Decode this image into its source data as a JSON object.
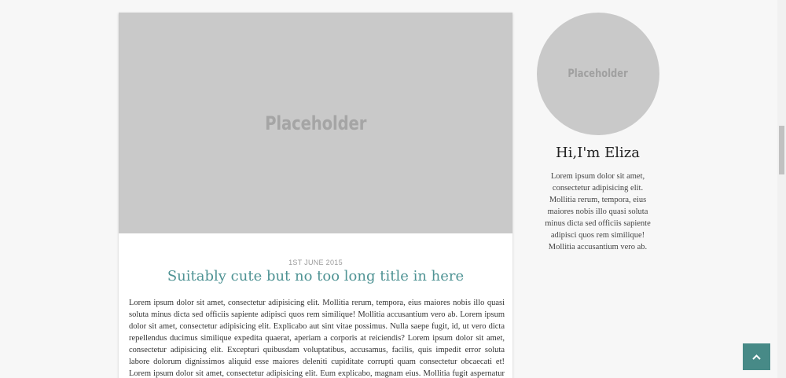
{
  "post": {
    "image_placeholder": "Placeholder",
    "date": "1ST JUNE 2015",
    "title": "Suitably cute but no too long title in here",
    "body": "Lorem ipsum dolor sit amet, consectetur adipisicing elit. Mollitia rerum, tempora, eius maiores nobis illo quasi soluta minus dicta sed officiis sapiente adipisci quos rem similique! Mollitia accusantium vero ab. Lorem ipsum dolor sit amet, consectetur adipisicing elit. Explicabo aut sint vitae possimus. Nulla saepe fugit, id, ut vero dicta repellendus ducimus similique expedita quaerat, aperiam a corporis at reiciendis? Lorem ipsum dolor sit amet, consectetur adipisicing elit. Excepturi quibusdam voluptatibus, accusamus, facilis, quis impedit error soluta labore dolorum dignissimos aliquid esse maiores deleniti cupiditate corrupti quam consectetur obcaecati et! Lorem ipsum dolor sit amet, consectetur adipisicing elit. Eum explicabo, magnam eius. Mollitia fugit aspernatur architecto eius amet delectus porro! Amet nemo eos"
  },
  "profile": {
    "avatar_placeholder": "Placeholder",
    "heading": "Hi,I'm Eliza",
    "bio": "Lorem ipsum dolor sit amet, consectetur adipisicing elit. Mollitia rerum, tempora, eius maiores nobis illo quasi soluta minus dicta sed officiis sapiente adipisci quos rem similique! Mollitia accusantium vero ab."
  },
  "controls": {
    "scroll_top_icon": "chevron-up-icon"
  },
  "colors": {
    "accent": "#4f9394",
    "button": "#478a87",
    "placeholder": "#c9c9c9",
    "background": "#f7f7f7"
  }
}
